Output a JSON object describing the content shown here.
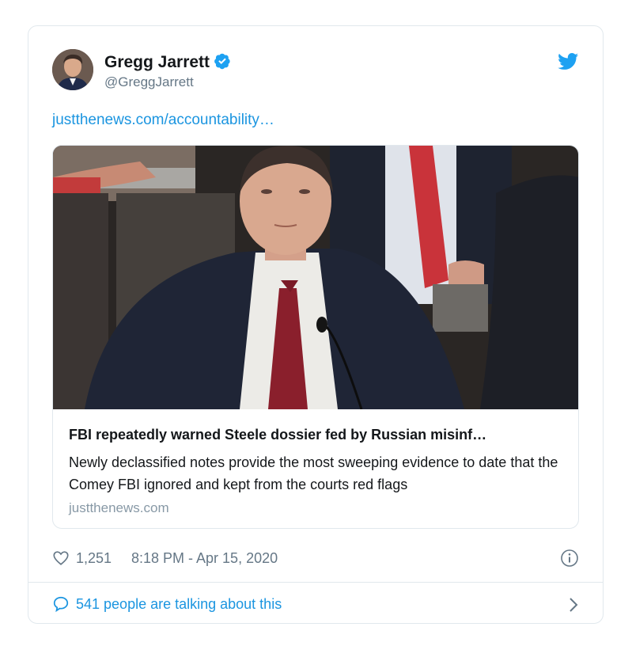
{
  "tweet": {
    "author_name": "Gregg Jarrett",
    "author_handle": "@GreggJarrett",
    "link_text": "justthenews.com/accountability…",
    "card": {
      "title": "FBI repeatedly warned Steele dossier fed by Russian misinf…",
      "description": "Newly declassified notes provide the most sweeping evidence to date that the Comey FBI ignored and kept from the courts red flags",
      "domain": "justthenews.com"
    },
    "likes": "1,251",
    "timestamp": "8:18 PM - Apr 15, 2020",
    "talking": "541 people are talking about this"
  },
  "icons": {
    "verified": "verified-badge-icon",
    "brand": "twitter-bird-icon",
    "like": "heart-icon",
    "info": "info-icon",
    "reply": "speech-bubble-icon",
    "more": "chevron-right-icon"
  },
  "colors": {
    "accent": "#1b95e0",
    "verified": "#1da1f2",
    "text": "#14171a",
    "muted": "#657786",
    "border": "#e1e8ed"
  }
}
